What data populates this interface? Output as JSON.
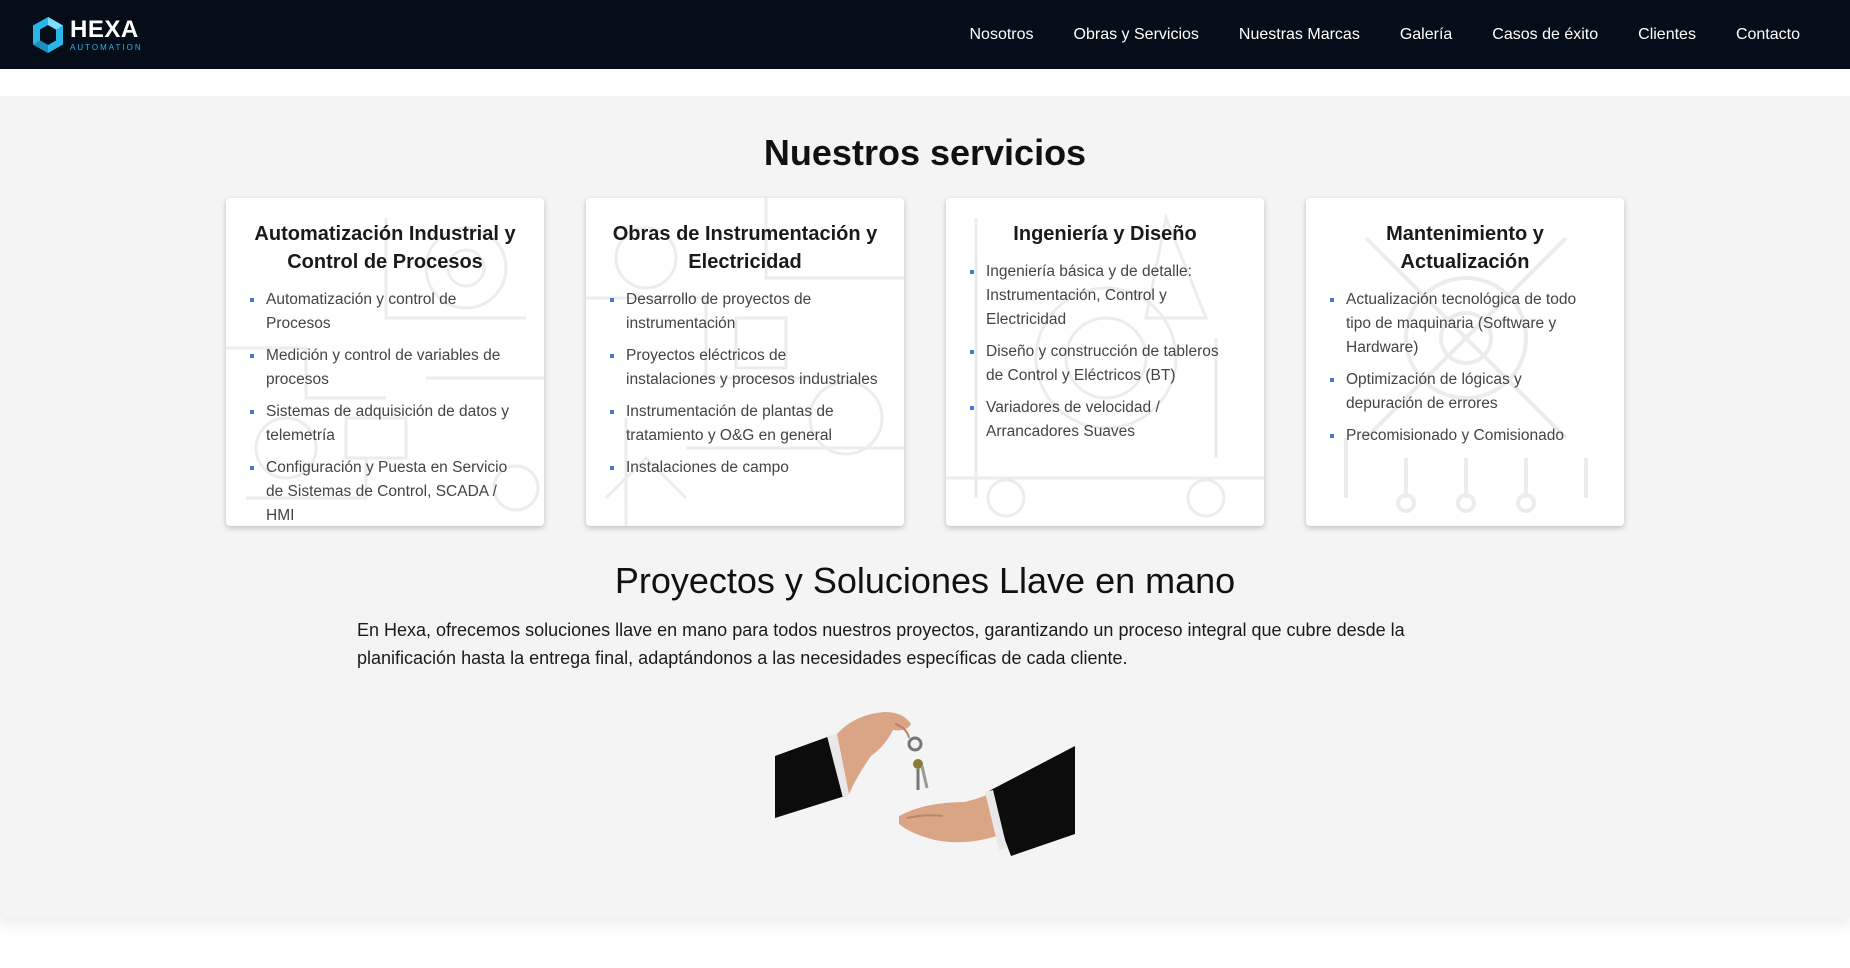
{
  "header": {
    "logo": {
      "name": "HEXA",
      "tagline": "AUTOMATION"
    },
    "nav": [
      {
        "label": "Nosotros"
      },
      {
        "label": "Obras y Servicios"
      },
      {
        "label": "Nuestras Marcas"
      },
      {
        "label": "Galería"
      },
      {
        "label": "Casos de éxito"
      },
      {
        "label": "Clientes"
      },
      {
        "label": "Contacto"
      }
    ]
  },
  "services": {
    "title": "Nuestros servicios",
    "cards": [
      {
        "title": "Automatización Industrial y Control de Procesos",
        "items": [
          "Automatización y control de Procesos",
          "Medición y control de variables de procesos",
          "Sistemas de adquisición de datos y telemetría",
          "Configuración y Puesta en Servicio de Sistemas de Control, SCADA / HMI"
        ]
      },
      {
        "title": "Obras de Instrumentación y Electricidad",
        "items": [
          "Desarrollo de proyectos de instrumentación",
          "Proyectos eléctricos de instalaciones y procesos industriales",
          "Instrumentación de plantas de tratamiento y O&G en general",
          "Instalaciones de campo"
        ]
      },
      {
        "title": "Ingeniería y Diseño",
        "items": [
          "Ingeniería básica y de detalle: Instrumentación, Control y Electricidad",
          "Diseño y construcción de tableros de Control y Eléctricos (BT)",
          "Variadores de velocidad / Arrancadores Suaves"
        ]
      },
      {
        "title": "Mantenimiento y Actualización",
        "items": [
          "Actualización tecnológica de todo tipo de maquinaria (Software y Hardware)",
          "Optimización de lógicas y depuración de errores",
          "Precomisionado y Comisionado"
        ]
      }
    ]
  },
  "turnkey": {
    "title": "Proyectos y Soluciones Llave en mano",
    "text": "En Hexa, ofrecemos soluciones llave en mano para todos nuestros proyectos, garantizando un proceso integral que cubre desde la planificación hasta la entrega final, adaptándonos a las necesidades específicas de cada cliente."
  },
  "colors": {
    "header_bg": "#050d19",
    "brand_cyan": "#29b6e8",
    "bullet_blue": "#3b7dd8",
    "section_bg": "#f4f4f4"
  }
}
